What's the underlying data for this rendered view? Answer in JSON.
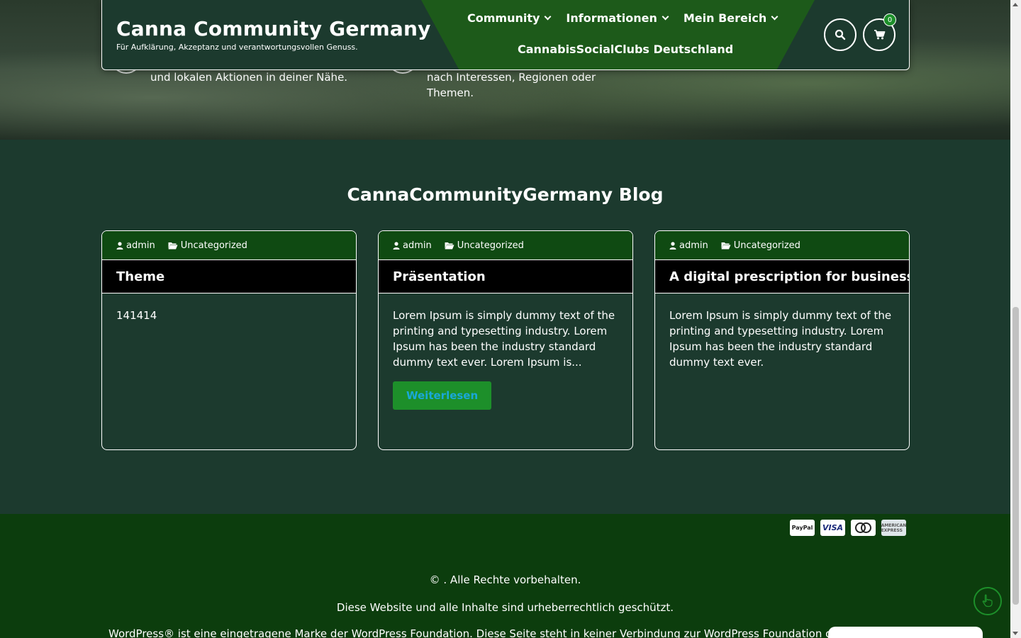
{
  "hero": {
    "text_1": "und lokalen Aktionen in deiner Nähe.",
    "text_2": "nach Interessen, Regionen oder Themen."
  },
  "header": {
    "title": "Canna Community Germany",
    "tagline": "Für Aufklärung, Akzeptanz und verantwortungsvollen Genuss.",
    "nav": [
      {
        "label": "Community"
      },
      {
        "label": "Informationen"
      },
      {
        "label": "Mein Bereich"
      }
    ],
    "nav_secondary": "CannabisSocialClubs Deutschland",
    "cart_count": "0",
    "search_icon": "search-icon",
    "cart_icon": "cart-icon"
  },
  "blog": {
    "title": "CannaCommunityGermany Blog",
    "posts": [
      {
        "author": "admin",
        "category": "Uncategorized",
        "title": "Theme",
        "excerpt": "141414"
      },
      {
        "author": "admin",
        "category": "Uncategorized",
        "title": "Präsentation",
        "excerpt": "Lorem Ipsum is simply dummy text of the printing and typesetting industry. Lorem Ipsum has been the industry standard dummy text ever. Lorem Ipsum is...",
        "read_more": "Weiterlesen"
      },
      {
        "author": "admin",
        "category": "Uncategorized",
        "title": "A digital prescription for business",
        "excerpt": "Lorem Ipsum is simply dummy text of the printing and typesetting industry. Lorem Ipsum has been the industry standard dummy text ever."
      }
    ]
  },
  "footer": {
    "payments": [
      "PayPal",
      "VISA",
      "MasterCard",
      "American Express"
    ],
    "copyright": "© . Alle Rechte vorbehalten.",
    "protected": "Diese Website und alle Inhalte sind urheberrechtlich geschützt.",
    "trademark": "WordPress® ist eine eingetragene Marke der WordPress Foundation. Diese Seite steht in keiner Verbindung zur WordPress Foundation oder A"
  },
  "colors": {
    "bg": "#1c3a2e",
    "nav_green": "#1d5a1a",
    "accent_green": "#1d8f2a",
    "footer_bg": "#0c3d0d",
    "card_meta": "#0f4a12"
  }
}
